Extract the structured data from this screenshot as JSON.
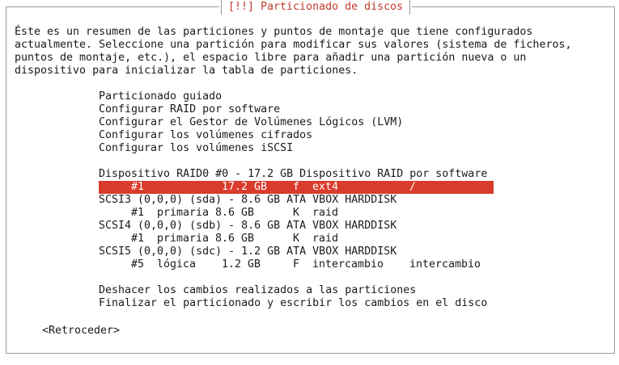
{
  "dialog": {
    "title": "[!!] Particionado de discos"
  },
  "intro": {
    "lines": [
      "Éste es un resumen de las particiones y puntos de montaje que tiene configurados",
      "actualmente. Seleccione una partición para modificar sus valores (sistema de ficheros,",
      "puntos de montaje, etc.), el espacio libre para añadir una partición nueva o un",
      "dispositivo para inicializar la tabla de particiones."
    ]
  },
  "menu": {
    "guided": "Particionado guiado",
    "raid": "Configurar RAID por software",
    "lvm": "Configurar el Gestor de Volúmenes Lógicos (LVM)",
    "encrypted": "Configurar los volúmenes cifrados",
    "iscsi": "Configurar los volúmenes iSCSI"
  },
  "devices": {
    "raid": {
      "label": "Dispositivo RAID0 #0 - 17.2 GB Dispositivo RAID por software",
      "partition": {
        "num": "#1",
        "size": "17.2 GB",
        "flag": "f",
        "fs": "ext4",
        "mount": "/"
      }
    },
    "scsi3": {
      "label": "SCSI3 (0,0,0) (sda) - 8.6 GB ATA VBOX HARDDISK",
      "partition": {
        "num": "#1",
        "type": "primaria",
        "size": "8.6 GB",
        "flag": "K",
        "fs": "raid"
      }
    },
    "scsi4": {
      "label": "SCSI4 (0,0,0) (sdb) - 8.6 GB ATA VBOX HARDDISK",
      "partition": {
        "num": "#1",
        "type": "primaria",
        "size": "8.6 GB",
        "flag": "K",
        "fs": "raid"
      }
    },
    "scsi5": {
      "label": "SCSI5 (0,0,0) (sdc) - 1.2 GB ATA VBOX HARDDISK",
      "partition": {
        "num": "#5",
        "type": "lógica",
        "size": "1.2 GB",
        "flag": "F",
        "fs": "intercambio",
        "mount": "intercambio"
      }
    }
  },
  "actions": {
    "undo": "Deshacer los cambios realizados a las particiones",
    "finish": "Finalizar el particionado y escribir los cambios en el disco"
  },
  "buttons": {
    "back": "<Retroceder>"
  },
  "colors": {
    "title": "#c0392b",
    "selection": "#d93b2c",
    "border": "#9a9a9a"
  }
}
